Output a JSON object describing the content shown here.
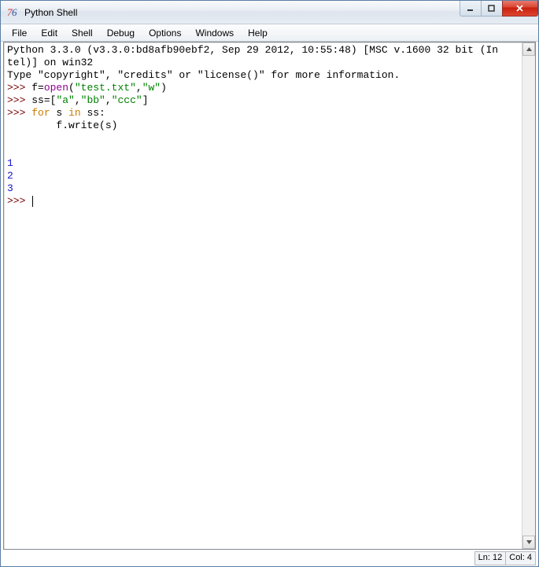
{
  "window": {
    "title": "Python Shell"
  },
  "menu": {
    "items": [
      "File",
      "Edit",
      "Shell",
      "Debug",
      "Options",
      "Windows",
      "Help"
    ]
  },
  "shell": {
    "banner_line1": "Python 3.3.0 (v3.3.0:bd8afb90ebf2, Sep 29 2012, 10:55:48) [MSC v.1600 32 bit (In",
    "banner_line2": "tel)] on win32",
    "banner_line3": "Type \"copyright\", \"credits\" or \"license()\" for more information.",
    "prompt": ">>> ",
    "l4_a": "f=",
    "l4_open": "open",
    "l4_b": "(",
    "l4_s1": "\"test.txt\"",
    "l4_c": ",",
    "l4_s2": "\"w\"",
    "l4_d": ")",
    "l5_a": "ss=[",
    "l5_s1": "\"a\"",
    "l5_c1": ",",
    "l5_s2": "\"bb\"",
    "l5_c2": ",",
    "l5_s3": "\"ccc\"",
    "l5_b": "]",
    "l6_for": "for",
    "l6_a": " s ",
    "l6_in": "in",
    "l6_b": " ss:",
    "l7": "        f.write(s)",
    "blank": "",
    "out1": "1",
    "out2": "2",
    "out3": "3"
  },
  "status": {
    "ln": "Ln: 12",
    "col": "Col: 4"
  }
}
